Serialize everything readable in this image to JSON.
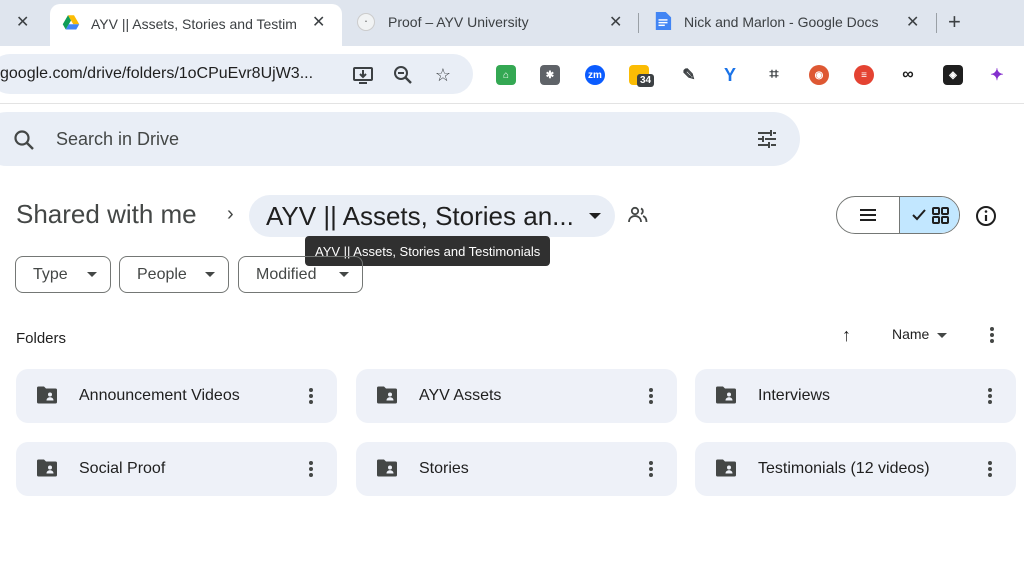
{
  "browser": {
    "tabs": [
      {
        "title": "AYV || Assets, Stories and Testimonials",
        "favicon": "google-drive-icon"
      },
      {
        "title": "Proof – AYV University",
        "favicon": "site-icon"
      },
      {
        "title": "Nick and Marlon - Google Docs",
        "favicon": "google-docs-icon"
      }
    ],
    "new_tab_label": "+",
    "url": "google.com/drive/folders/1oCPuEvr8UjW3...",
    "extensions": [
      {
        "name": "ext-green-icon",
        "color": "#34a853"
      },
      {
        "name": "hubspot-icon",
        "color": "#5f6368"
      },
      {
        "name": "zoom-icon",
        "color": "#0b5cff",
        "label": "zm"
      },
      {
        "name": "calendar-icon",
        "color": "#fbbc04",
        "label": "34"
      },
      {
        "name": "pen-icon",
        "color": "#5f6368"
      },
      {
        "name": "funnel-icon",
        "color": "#1a73e8"
      },
      {
        "name": "screenshot-icon",
        "color": "#3c4043"
      },
      {
        "name": "duckduckgo-icon",
        "color": "#de5833"
      },
      {
        "name": "todoist-icon",
        "color": "#e44332"
      },
      {
        "name": "link-icon",
        "color": "#1f1f1f"
      },
      {
        "name": "layers-icon",
        "color": "#1f1f1f"
      },
      {
        "name": "sparkle-icon",
        "color": "#8430ce"
      }
    ]
  },
  "search": {
    "placeholder": "Search in Drive"
  },
  "breadcrumb": {
    "root": "Shared with me",
    "current": "AYV || Assets, Stories an...",
    "tooltip": "AYV || Assets, Stories and Testimonials"
  },
  "filters": [
    "Type",
    "People",
    "Modified"
  ],
  "folders_section": {
    "title": "Folders",
    "sort_label": "Name",
    "items": [
      "Announcement Videos",
      "AYV Assets",
      "Interviews",
      "Social Proof",
      "Stories",
      "Testimonials (12 videos)"
    ]
  },
  "colors": {
    "accent": "#c2e7ff",
    "surface": "#e9eef6",
    "card": "#eef1f8"
  }
}
